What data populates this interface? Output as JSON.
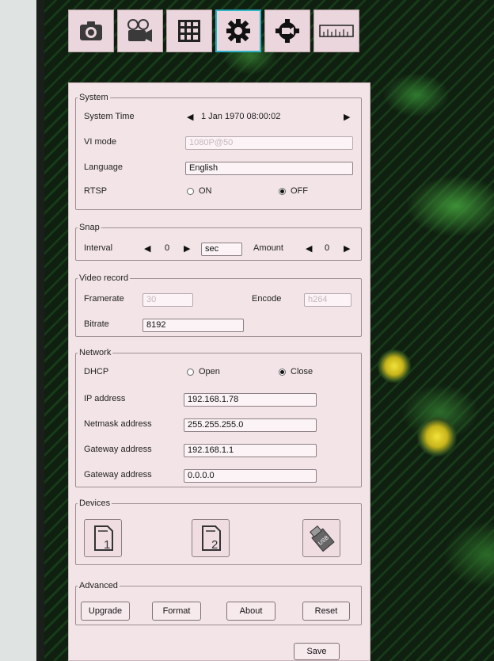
{
  "toolbar": {
    "icons": [
      "camera-icon",
      "video-record-icon",
      "grid-icon",
      "gear-icon",
      "camera-settings-icon",
      "ruler-icon"
    ],
    "active_index": 3
  },
  "system": {
    "legend": "System",
    "time_label": "System Time",
    "time_value": "1 Jan 1970 08:00:02",
    "vi_label": "VI mode",
    "vi_value": "1080P@50",
    "language_label": "Language",
    "language_value": "English",
    "rtsp_label": "RTSP",
    "rtsp_on": "ON",
    "rtsp_off": "OFF",
    "rtsp_selected": "OFF"
  },
  "snap": {
    "legend": "Snap",
    "interval_label": "Interval",
    "interval_value": "0",
    "interval_unit": "sec",
    "amount_label": "Amount",
    "amount_value": "0"
  },
  "video": {
    "legend": "Video record",
    "framerate_label": "Framerate",
    "framerate_value": "30",
    "encode_label": "Encode",
    "encode_value": "h264",
    "bitrate_label": "Bitrate",
    "bitrate_value": "8192"
  },
  "network": {
    "legend": "Network",
    "dhcp_label": "DHCP",
    "dhcp_open": "Open",
    "dhcp_close": "Close",
    "dhcp_selected": "Close",
    "ip_label": "IP address",
    "ip_value": "192.168.1.78",
    "netmask_label": "Netmask address",
    "netmask_value": "255.255.255.0",
    "gateway_label": "Gateway address",
    "gateway_value": "192.168.1.1",
    "gateway2_label": "Gateway address",
    "gateway2_value": "0.0.0.0"
  },
  "devices": {
    "legend": "Devices",
    "sd1_icon": "sd-card-1-icon",
    "sd2_icon": "sd-card-2-icon",
    "usb_icon": "usb-drive-icon",
    "sd1_digit": "1",
    "sd2_digit": "2",
    "usb_text": "USB"
  },
  "advanced": {
    "legend": "Advanced",
    "upgrade": "Upgrade",
    "format": "Format",
    "about": "About",
    "reset": "Reset"
  },
  "save_label": "Save"
}
